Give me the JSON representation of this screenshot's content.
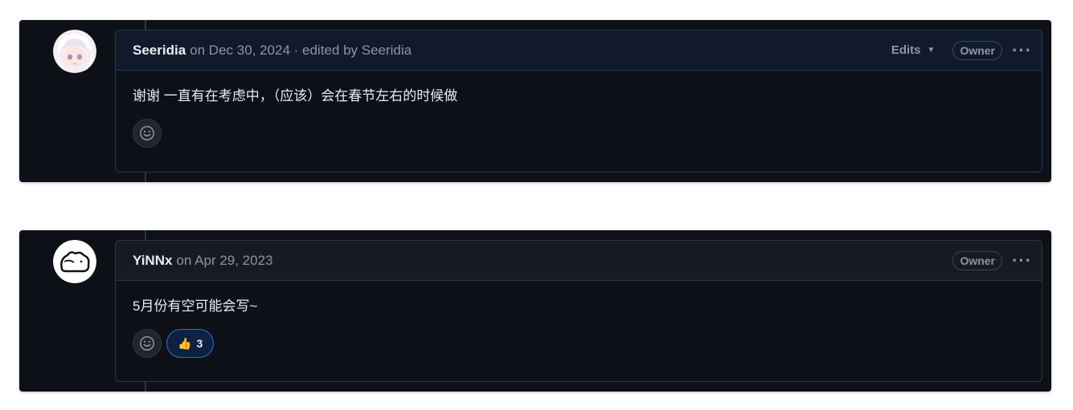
{
  "comments": [
    {
      "author": "Seeridia",
      "meta": "on Dec 30, 2024 · edited by Seeridia",
      "edits_label": "Edits",
      "badge": "Owner",
      "body": "谢谢 一直有在考虑中，（应该）会在春节左右的时候做",
      "reactions": []
    },
    {
      "author": "YiNNx",
      "meta": "on Apr 29, 2023",
      "badge": "Owner",
      "body": "5月份有空可能会写~",
      "reactions": [
        {
          "emoji": "thumbs-up",
          "glyph": "👍",
          "count": "3"
        }
      ]
    }
  ],
  "colors": {
    "background": "#0d1117",
    "header": "#161b22",
    "border": "#30363d",
    "text": "#e6edf3",
    "muted": "#8d96a0",
    "accent": "#2f6fd0"
  }
}
